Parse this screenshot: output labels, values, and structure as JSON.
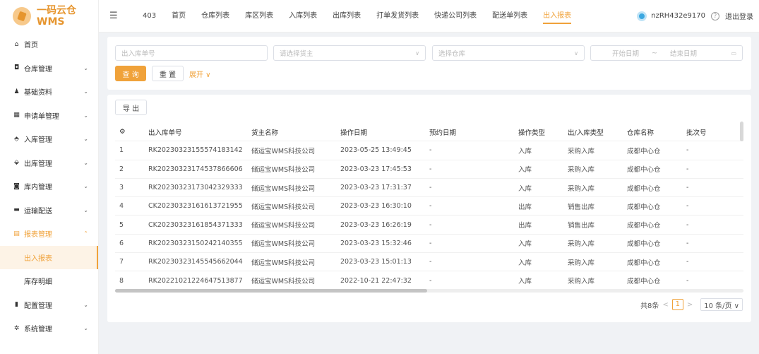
{
  "logo": {
    "line1": "一码云仓",
    "line2": "WMS"
  },
  "sidebar": {
    "items": [
      {
        "icon": "home-icon",
        "glyph": "⌂",
        "label": "首页",
        "chevron": ""
      },
      {
        "icon": "warehouse-icon",
        "glyph": "◘",
        "label": "仓库管理",
        "chevron": "⌄"
      },
      {
        "icon": "user-icon",
        "glyph": "♟",
        "label": "基础资料",
        "chevron": "⌄"
      },
      {
        "icon": "form-icon",
        "glyph": "▦",
        "label": "申请单管理",
        "chevron": "⌄"
      },
      {
        "icon": "inbound-icon",
        "glyph": "⬘",
        "label": "入库管理",
        "chevron": "⌄"
      },
      {
        "icon": "outbound-icon",
        "glyph": "⬙",
        "label": "出库管理",
        "chevron": "⌄"
      },
      {
        "icon": "inventory-icon",
        "glyph": "◙",
        "label": "库内管理",
        "chevron": "⌄"
      },
      {
        "icon": "truck-icon",
        "glyph": "▬",
        "label": "运输配送",
        "chevron": "⌄"
      },
      {
        "icon": "report-icon",
        "glyph": "▤",
        "label": "报表管理",
        "chevron": "⌃"
      }
    ],
    "sub_items": [
      {
        "label": "出入报表"
      },
      {
        "label": "库存明细"
      }
    ],
    "items_after": [
      {
        "icon": "config-icon",
        "glyph": "▮",
        "label": "配置管理",
        "chevron": "⌄"
      },
      {
        "icon": "settings-icon",
        "glyph": "✲",
        "label": "系统管理",
        "chevron": "⌄"
      }
    ]
  },
  "topbar": {
    "tabs": [
      "403",
      "首页",
      "仓库列表",
      "库区列表",
      "入库列表",
      "出库列表",
      "打单发货列表",
      "快递公司列表",
      "配送单列表",
      "出入报表"
    ],
    "active_tab": 9,
    "username": "nzRH432e9170",
    "help": "?",
    "logout": "退出登录"
  },
  "filters": {
    "order_no_placeholder": "出入库单号",
    "owner_placeholder": "请选择货主",
    "warehouse_placeholder": "选择仓库",
    "start_date_placeholder": "开始日期",
    "date_sep": "~",
    "end_date_placeholder": "结束日期",
    "search_label": "查 询",
    "reset_label": "重 置",
    "expand_label": "展开 ∨"
  },
  "table": {
    "export_label": "导 出",
    "columns": [
      "出入库单号",
      "货主名称",
      "操作日期",
      "预约日期",
      "操作类型",
      "出/入库类型",
      "仓库名称",
      "批次号"
    ],
    "rows": [
      [
        "1",
        "RK20230323155574183142",
        "储运宝WMS科技公司",
        "2023-05-25 13:49:45",
        "-",
        "入库",
        "采购入库",
        "成都中心仓",
        "-"
      ],
      [
        "2",
        "RK20230323174537866606",
        "储运宝WMS科技公司",
        "2023-03-23 17:45:53",
        "-",
        "入库",
        "采购入库",
        "成都中心仓",
        "-"
      ],
      [
        "3",
        "RK20230323173042329333",
        "储运宝WMS科技公司",
        "2023-03-23 17:31:37",
        "-",
        "入库",
        "采购入库",
        "成都中心仓",
        "-"
      ],
      [
        "4",
        "CK20230323161613721955",
        "储运宝WMS科技公司",
        "2023-03-23 16:30:10",
        "-",
        "出库",
        "销售出库",
        "成都中心仓",
        "-"
      ],
      [
        "5",
        "CK20230323161854371333",
        "储运宝WMS科技公司",
        "2023-03-23 16:26:19",
        "-",
        "出库",
        "销售出库",
        "成都中心仓",
        "-"
      ],
      [
        "6",
        "RK20230323150242140355",
        "储运宝WMS科技公司",
        "2023-03-23 15:32:46",
        "-",
        "入库",
        "采购入库",
        "成都中心仓",
        "-"
      ],
      [
        "7",
        "RK20230323145545662044",
        "储运宝WMS科技公司",
        "2023-03-23 15:01:13",
        "-",
        "入库",
        "采购入库",
        "成都中心仓",
        "-"
      ],
      [
        "8",
        "RK20221021224647513877",
        "储运宝WMS科技公司",
        "2022-10-21 22:47:32",
        "-",
        "入库",
        "采购入库",
        "成都中心仓",
        "-"
      ]
    ]
  },
  "pagination": {
    "total": "共8条",
    "prev": "<",
    "page": "1",
    "next": ">",
    "page_size": "10 条/页 ∨"
  },
  "colors": {
    "accent": "#f0a23a",
    "background": "#f0f2f5"
  }
}
